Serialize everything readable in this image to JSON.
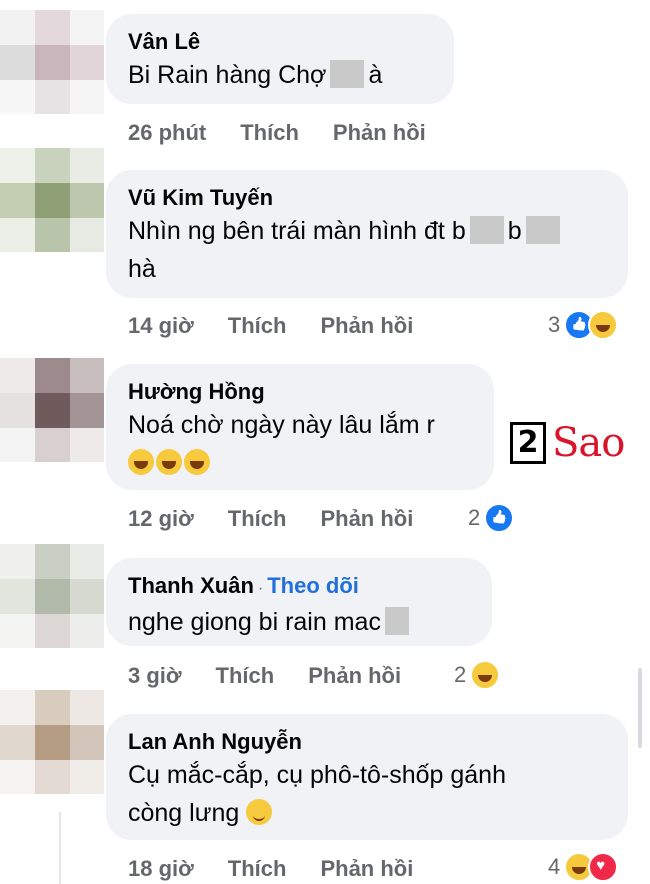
{
  "comments": [
    {
      "name": "Vân Lê",
      "text_before": "Bi Rain hàng  Chợ",
      "text_after": "à",
      "time": "26 phút",
      "like": "Thích",
      "reply": "Phản hồi"
    },
    {
      "name": "Vũ Kim Tuyến",
      "text_line1": "Nhìn ng bên trái màn hình đt b",
      "text_line1b": "b",
      "text_line2": "hà",
      "time": "14 giờ",
      "like": "Thích",
      "reply": "Phản hồi",
      "reaction_count": "3"
    },
    {
      "name": "Hường Hồng",
      "text": "Noá chờ ngày này lâu lắm r",
      "time": "12 giờ",
      "like": "Thích",
      "reply": "Phản hồi",
      "reaction_count": "2"
    },
    {
      "name": "Thanh Xuân",
      "follow": "Theo dõi",
      "text": "nghe giong bi rain   mac",
      "time": "3 giờ",
      "like": "Thích",
      "reply": "Phản hồi",
      "reaction_count": "2"
    },
    {
      "name": "Lan Anh Nguyễn",
      "text_line1": "Cụ mắc-cắp, cụ phô-tô-shốp gánh",
      "text_line2": "còng lưng",
      "time": "18 giờ",
      "like": "Thích",
      "reply": "Phản hồi",
      "reaction_count": "4"
    }
  ],
  "watermark": {
    "box": "2",
    "text": "Sao"
  },
  "colors": {
    "bubble": "#f0f2f5",
    "meta": "#65676b",
    "follow": "#216fdb",
    "logo": "#d7142a"
  }
}
